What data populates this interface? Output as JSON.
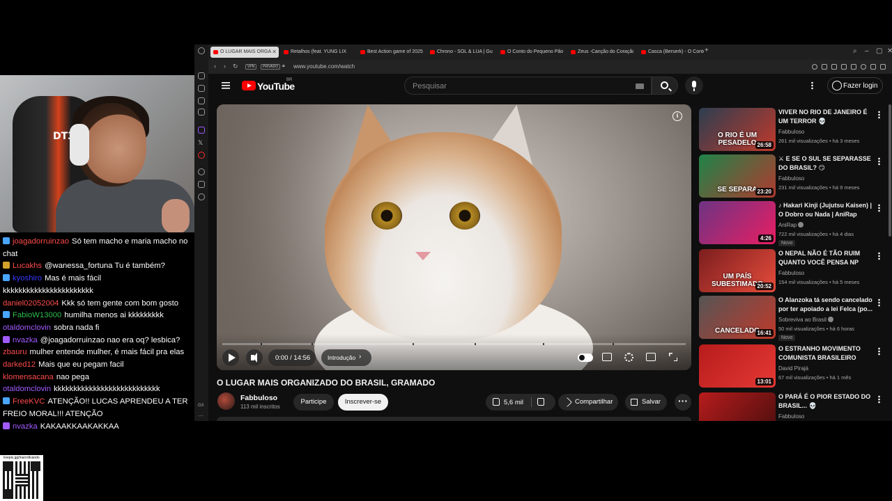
{
  "chat": [
    {
      "user": "joagadorruinzao",
      "color": "#ff4b4b",
      "badge": "#49a5ff",
      "text": "Só tem macho e maria macho no chat"
    },
    {
      "user": "Lucakhs",
      "color": "#ff4b4b",
      "badge": "#d4a12a",
      "text": "@wanessa_fortuna Tu é também?"
    },
    {
      "user": "kyoshiro",
      "color": "#3a3aff",
      "badge": "#49a5ff",
      "text": "Mas é mais fácil kkkkkkkkkkkkkkkkkkkkkkk"
    },
    {
      "user": "daniel02052004",
      "color": "#ff4b4b",
      "badge": "",
      "text": "Kkk só tem gente com bom gosto"
    },
    {
      "user": "FabioW13000",
      "color": "#2fbf50",
      "badge": "#49a5ff",
      "text": "humilha menos ai kkkkkkkkk"
    },
    {
      "user": "otaldomclovin",
      "color": "#a25bff",
      "badge": "",
      "text": "sobra nada fi"
    },
    {
      "user": "nvazka",
      "color": "#a25bff",
      "badge": "#a25bff",
      "text": "@joagadorruinzao nao era oq? lesbica?"
    },
    {
      "user": "zbauru",
      "color": "#ff4b4b",
      "badge": "",
      "text": "mulher entende mulher, é mais fácil pra elas"
    },
    {
      "user": "darked12",
      "color": "#ff4b4b",
      "badge": "",
      "text": "Mais que eu pegam facil"
    },
    {
      "user": "klomensacana",
      "color": "#ff4b4b",
      "badge": "",
      "text": "nao pega"
    },
    {
      "user": "otaldomclovin",
      "color": "#a25bff",
      "badge": "",
      "text": "kkkkkkkkkkkkkkkkkkkkkkkkkkk"
    },
    {
      "user": "FreeKVC",
      "color": "#ff4b4b",
      "badge": "#49a5ff",
      "text": "ATENÇÃO!! LUCAS APRENDEU A TER FREIO MORAL!!! ATENÇÃO"
    },
    {
      "user": "nvazka",
      "color": "#a25bff",
      "badge": "#a25bff",
      "text": "KAKAAKKAAKAKKAA"
    }
  ],
  "qr": {
    "label": "livepix.gg/marrotlvando"
  },
  "browser": {
    "tabs": [
      {
        "label": "O LUGAR MAIS ORGA",
        "active": true
      },
      {
        "label": "Retalhos (feat. YUNG LIX)",
        "active": false
      },
      {
        "label": "Best Action game of 2025",
        "active": false
      },
      {
        "label": "Chrono - SOL & LUA | Gu",
        "active": false
      },
      {
        "label": "O Conto do Pequeno Pão",
        "active": false
      },
      {
        "label": "Zeus -Canção do Coração",
        "active": false
      },
      {
        "label": "Casca (Berserk) - O Conto",
        "active": false
      }
    ],
    "vpn": "VPN",
    "private": "PRIVADO",
    "url": "www.youtube.com/watch"
  },
  "youtube": {
    "logo_text": "YouTube",
    "country": "BR",
    "search_placeholder": "Pesquisar",
    "login_label": "Fazer login"
  },
  "player": {
    "time": "0:00 / 14:56",
    "chapter": "Introdução",
    "progress_fraction": 0.0,
    "info_label": "i"
  },
  "video": {
    "title": "O LUGAR MAIS ORGANIZADO DO BRASIL, GRAMADO",
    "channel": "Fabbuloso",
    "subscribers": "113 mil inscritos",
    "join_label": "Participe",
    "subscribe_label": "Inscrever-se",
    "likes": "5,6 mil",
    "share_label": "Compartilhar",
    "save_label": "Salvar"
  },
  "recommendations": [
    {
      "title": "VIVER NO RIO DE JANEIRO É UM TERROR 💀",
      "channel": "Fabbuloso",
      "meta": "261 mil visualizações • há 3 meses",
      "duration": "26:58",
      "thumb_text": "O RIO É UM PESADELO",
      "thumb_colors": [
        "#2c3e50",
        "#c0392b"
      ],
      "novo": false,
      "verified": false
    },
    {
      "title": "⚔ E SE O SUL SE SEPARASSE DO BRASIL? 😏",
      "channel": "Fabbuloso",
      "meta": "231 mil visualizações • há 9 meses",
      "duration": "23:20",
      "thumb_text": "SE SEPARA",
      "thumb_colors": [
        "#1e8449",
        "#b03a2e"
      ],
      "novo": false,
      "verified": false
    },
    {
      "title": "♪ Hakari Kinji (Jujutsu Kaisen) | O Dobro ou Nada | AniRap",
      "channel": "AniRap",
      "meta": "722 mil visualizações • há 4 dias",
      "duration": "4:26",
      "thumb_text": "",
      "thumb_colors": [
        "#6c3483",
        "#e91e63"
      ],
      "novo": true,
      "verified": true
    },
    {
      "title": "O NEPAL NÃO É TÃO RUIM QUANTO VOCÊ PENSA NP",
      "channel": "Fabbuloso",
      "meta": "154 mil visualizações • há 5 meses",
      "duration": "20:52",
      "thumb_text": "UM PAÍS SUBESTIMADO",
      "thumb_colors": [
        "#7b1e1e",
        "#e74c3c"
      ],
      "novo": false,
      "verified": false
    },
    {
      "title": "O Alanzoka tá sendo cancelado por ter apoiado a lei Felca (po...",
      "channel": "Sobreviva ao Brasil",
      "meta": "50 mil visualizações • há 6 horas",
      "duration": "16:41",
      "thumb_text": "CANCELADO",
      "thumb_colors": [
        "#555555",
        "#c0392b"
      ],
      "novo": true,
      "verified": true
    },
    {
      "title": "O ESTRANHO MOVIMENTO COMUNISTA BRASILEIRO",
      "channel": "David Pirajá",
      "meta": "67 mil visualizações • há 1 mês",
      "duration": "13:01",
      "thumb_text": "",
      "thumb_colors": [
        "#b71c1c",
        "#e53935"
      ],
      "novo": false,
      "verified": false
    },
    {
      "title": "O PARÁ É O PIOR ESTADO DO BRASIL... 💀",
      "channel": "Fabbuloso",
      "meta": "",
      "duration": "",
      "thumb_text": "",
      "thumb_colors": [
        "#b71c1c",
        "#4a0e0e"
      ],
      "novo": false,
      "verified": false
    }
  ]
}
